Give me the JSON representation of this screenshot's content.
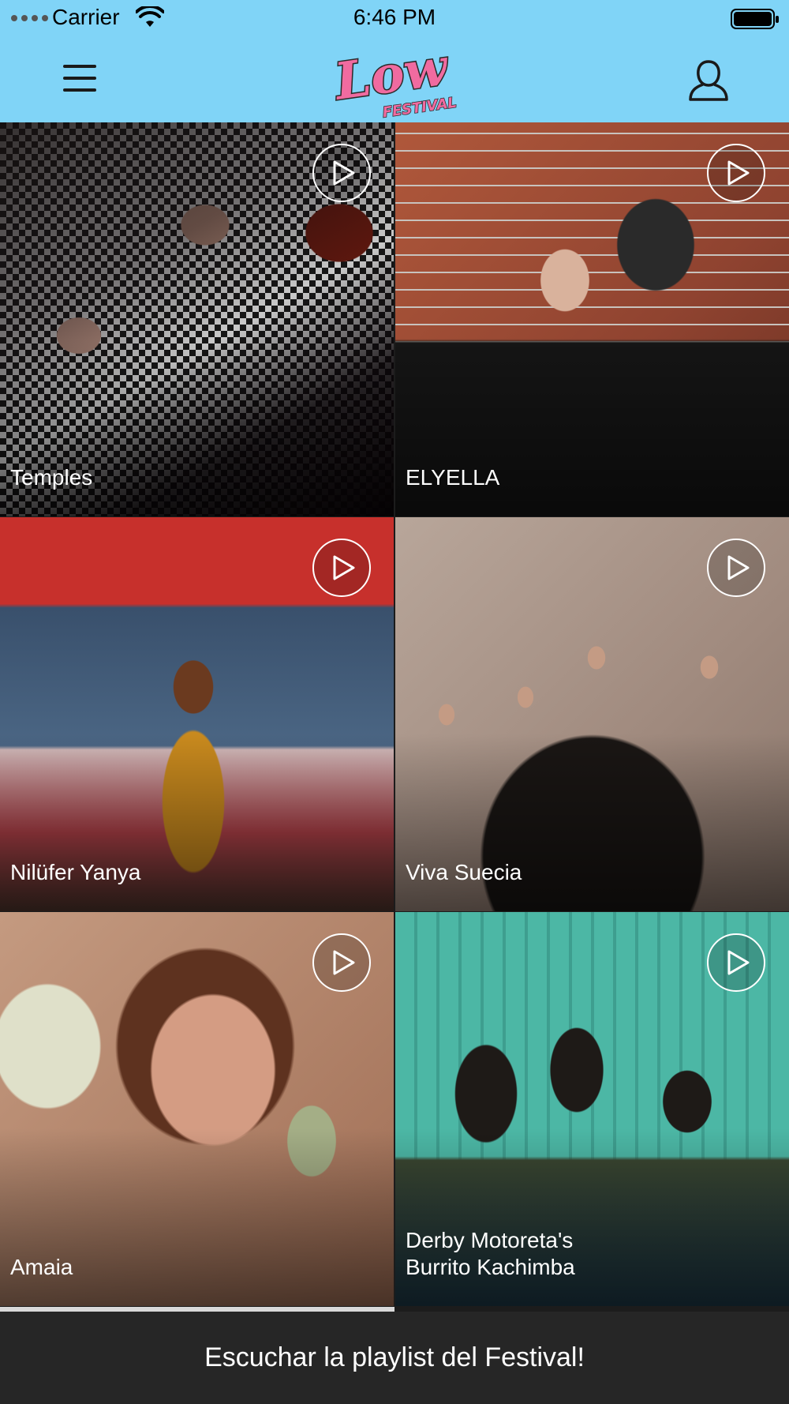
{
  "status_bar": {
    "carrier": "Carrier",
    "time": "6:46 PM"
  },
  "nav": {
    "logo_text": "Low",
    "logo_subtext": "FESTIVAL",
    "menu_icon": "hamburger-menu-icon",
    "user_icon": "user-profile-icon"
  },
  "artists": [
    {
      "name": "Temples"
    },
    {
      "name": "ELYELLA"
    },
    {
      "name": "Nilüfer Yanya"
    },
    {
      "name": "Viva Suecia"
    },
    {
      "name": "Amaia"
    },
    {
      "name": "Derby Motoreta's\nBurrito Kachimba"
    }
  ],
  "playlist_button": {
    "label": "Escuchar la playlist del Festival!"
  },
  "colors": {
    "nav_background": "#80d4f7",
    "logo_pink": "#f06ba0",
    "bottom_bar": "#262626"
  }
}
